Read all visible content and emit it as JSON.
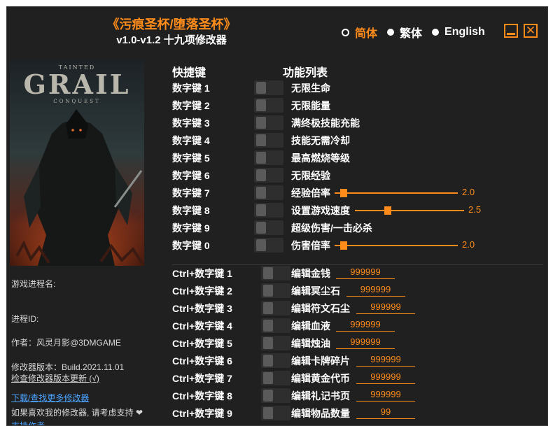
{
  "header": {
    "title": "《污痕圣杯/堕落圣杯》",
    "subtitle": "v1.0-v1.2 十九项修改器",
    "languages": [
      {
        "label": "简体",
        "active": true
      },
      {
        "label": "繁体",
        "active": false
      },
      {
        "label": "English",
        "active": false
      }
    ]
  },
  "cover": {
    "logo_top": "TAINTED",
    "logo_main": "GRAIL",
    "logo_sub": "CONQUEST"
  },
  "info": {
    "process_name_label": "游戏进程名:",
    "process_id_label": "进程ID:",
    "author": "作者：风灵月影@3DMGAME",
    "version": "修改器版本：Build.2021.11.01",
    "check_update": "检查修改器版本更新 (√)",
    "download_link": "下载/查找更多修改器",
    "support_text": "如果喜欢我的修改器, 请考虑支持 ❤",
    "support_link": "支持作者"
  },
  "table": {
    "hotkey_header": "快捷键",
    "feature_header": "功能列表"
  },
  "rows": [
    {
      "hotkey": "数字键 1",
      "feature": "无限生命"
    },
    {
      "hotkey": "数字键 2",
      "feature": "无限能量"
    },
    {
      "hotkey": "数字键 3",
      "feature": "满终极技能充能"
    },
    {
      "hotkey": "数字键 4",
      "feature": "技能无需冷却"
    },
    {
      "hotkey": "数字键 5",
      "feature": "最高燃烧等级"
    },
    {
      "hotkey": "数字键 6",
      "feature": "无限经验"
    },
    {
      "hotkey": "数字键 7",
      "feature": "经验倍率",
      "slider_value": "2.0",
      "slider_level": 0.0
    },
    {
      "hotkey": "数字键 8",
      "feature": "设置游戏速度",
      "slider_value": "2.5",
      "slider_level": 0.25
    },
    {
      "hotkey": "数字键 9",
      "feature": "超级伤害/一击必杀"
    },
    {
      "hotkey": "数字键 0",
      "feature": "伤害倍率",
      "slider_value": "2.0",
      "slider_level": 0.0
    },
    {
      "hotkey": "Ctrl+数字键 1",
      "feature": "编辑金钱",
      "input_value": "999999"
    },
    {
      "hotkey": "Ctrl+数字键 2",
      "feature": "编辑冥尘石",
      "input_value": "999999"
    },
    {
      "hotkey": "Ctrl+数字键 3",
      "feature": "编辑符文石尘",
      "input_value": "999999"
    },
    {
      "hotkey": "Ctrl+数字键 4",
      "feature": "编辑血液",
      "input_value": "999999"
    },
    {
      "hotkey": "Ctrl+数字键 5",
      "feature": "编辑烛油",
      "input_value": "999999"
    },
    {
      "hotkey": "Ctrl+数字键 6",
      "feature": "编辑卡牌碎片",
      "input_value": "999999"
    },
    {
      "hotkey": "Ctrl+数字键 7",
      "feature": "编辑黄金代币",
      "input_value": "999999"
    },
    {
      "hotkey": "Ctrl+数字键 8",
      "feature": "编辑礼记书页",
      "input_value": "999999"
    },
    {
      "hotkey": "Ctrl+数字键 9",
      "feature": "编辑物品数量",
      "input_value": "99"
    }
  ],
  "colors": {
    "accent": "#ff8c1a",
    "background": "#202020",
    "link": "#4aa3ff"
  }
}
